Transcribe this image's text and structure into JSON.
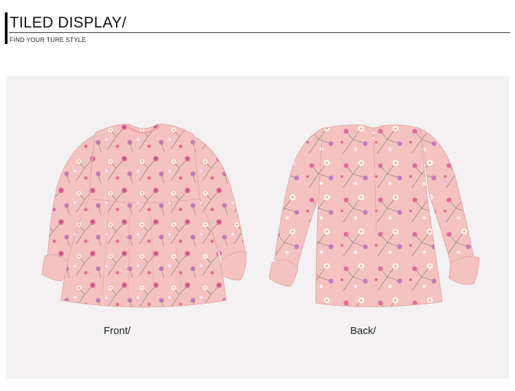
{
  "header": {
    "title": "TILED DISPLAY/",
    "subtitle": "FIND YOUR TURE STYLE"
  },
  "panel": {
    "front_label": "Front/",
    "back_label": "Back/"
  },
  "colors": {
    "background": "#ffffff",
    "panel": "#f3f1f2",
    "fabric": "#f4c3c1",
    "flower_pink": "#e36a9b",
    "flower_purple": "#c27bbf",
    "flower_white": "#fbf0f2",
    "stem": "#8d8b78"
  }
}
